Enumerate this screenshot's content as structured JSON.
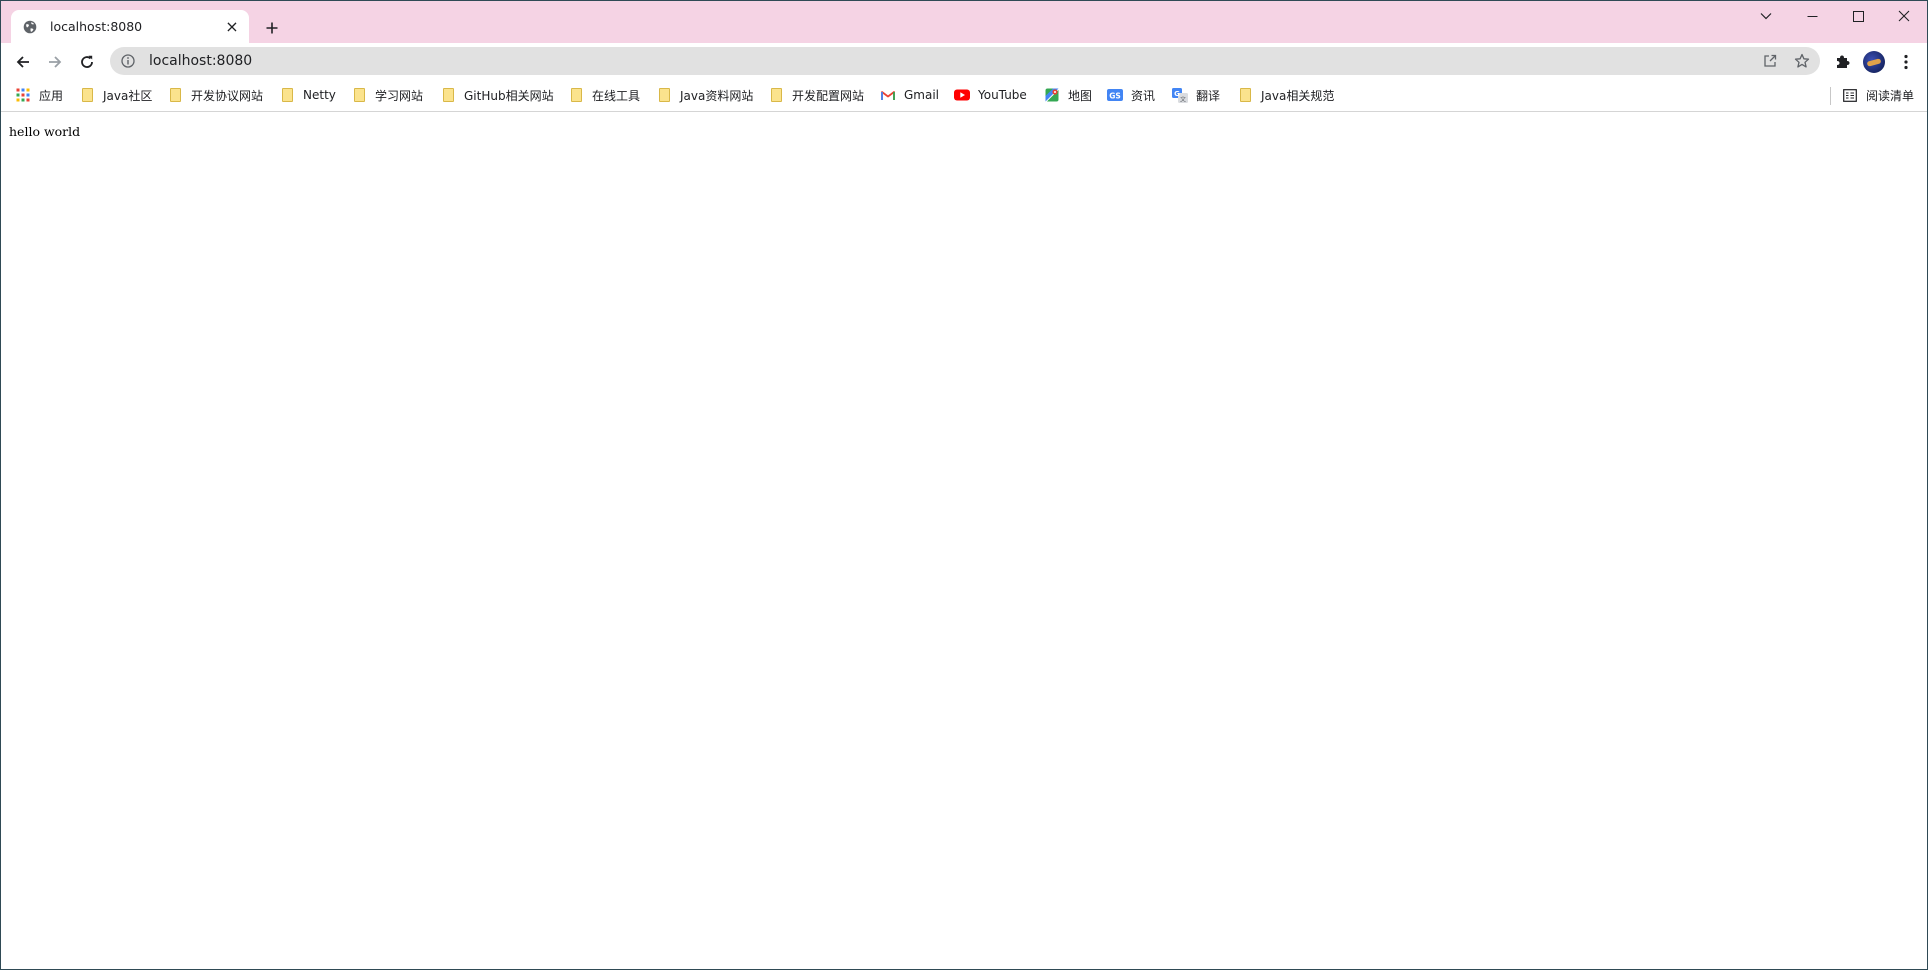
{
  "tab": {
    "title": "localhost:8080",
    "close_glyph": "×",
    "favicon": "globe-icon"
  },
  "window_controls": [
    "chevron-down-icon",
    "minimize-icon",
    "maximize-icon",
    "close-icon"
  ],
  "omnibox": {
    "url": "localhost:8080"
  },
  "bookmarks": [
    {
      "label": "应用",
      "icon": "apps-grid-icon"
    },
    {
      "label": "Java社区",
      "icon": "folder-icon"
    },
    {
      "label": "开发协议网站",
      "icon": "folder-icon"
    },
    {
      "label": "Netty",
      "icon": "folder-icon"
    },
    {
      "label": "学习网站",
      "icon": "folder-icon"
    },
    {
      "label": "GitHub相关网站",
      "icon": "folder-icon"
    },
    {
      "label": "在线工具",
      "icon": "folder-icon"
    },
    {
      "label": "Java资料网站",
      "icon": "folder-icon"
    },
    {
      "label": "开发配置网站",
      "icon": "folder-icon"
    },
    {
      "label": "Gmail",
      "icon": "gmail-icon"
    },
    {
      "label": "YouTube",
      "icon": "youtube-icon"
    },
    {
      "label": "地图",
      "icon": "maps-icon"
    },
    {
      "label": "资讯",
      "icon": "news-icon"
    },
    {
      "label": "翻译",
      "icon": "translate-icon"
    },
    {
      "label": "Java相关规范",
      "icon": "folder-icon"
    }
  ],
  "reading_list": {
    "label": "阅读清单",
    "icon": "reading-list-icon"
  },
  "page": {
    "body_text": "hello world"
  },
  "colors": {
    "tabstrip_bg": "#f5d3e4",
    "omnibox_bg": "#e1e1e1",
    "folder_fill": "#fbe38d",
    "youtube_red": "#ff0000"
  }
}
